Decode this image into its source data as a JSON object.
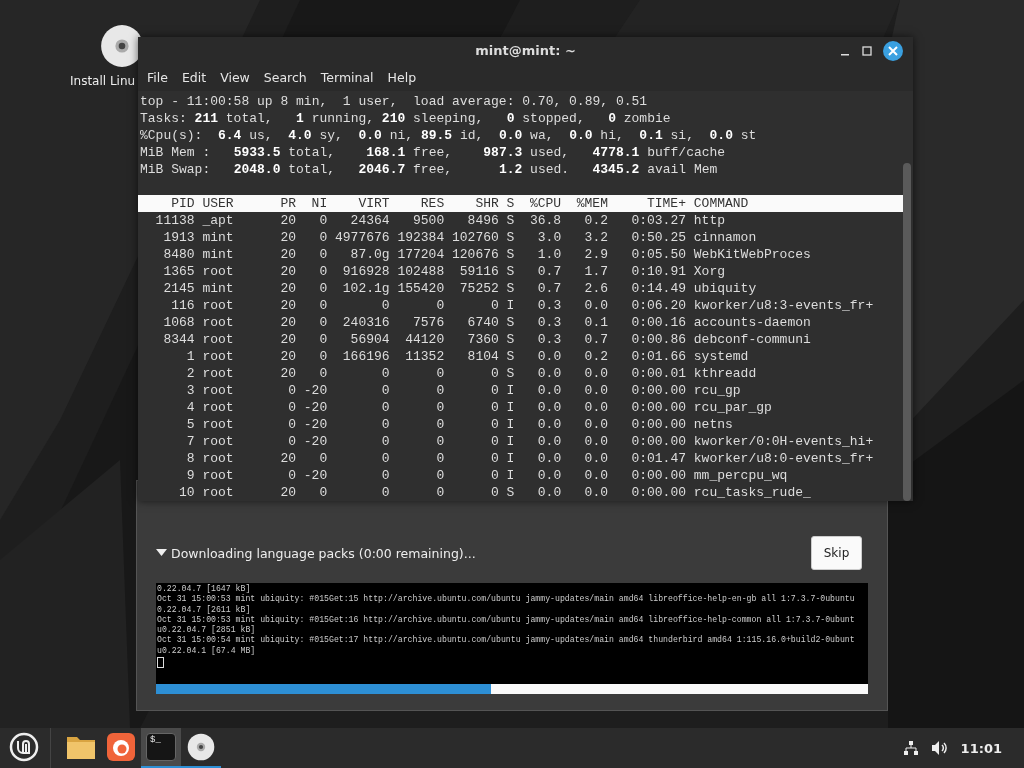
{
  "desktop_icons": [
    {
      "label": "Install Linu"
    }
  ],
  "terminal": {
    "title": "mint@mint: ~",
    "menu": [
      "File",
      "Edit",
      "View",
      "Search",
      "Terminal",
      "Help"
    ],
    "summary": [
      "top - 11:00:58 up 8 min,  1 user,  load average: 0.70, 0.89, 0.51",
      "Tasks: **211** total,   **1** running, **210** sleeping,   **0** stopped,   **0** zombie",
      "%Cpu(s):  **6.4** us,  **4.0** sy,  **0.0** ni, **89.5** id,  **0.0** wa,  **0.0** hi,  **0.1** si,  **0.0** st",
      "MiB Mem :   **5933.5** total,    **168.1** free,    **987.3** used,   **4778.1** buff/cache",
      "MiB Swap:   **2048.0** total,   **2046.7** free,      **1.2** used.   **4345.2** avail Mem"
    ],
    "columns": [
      "PID",
      "USER",
      "PR",
      "NI",
      "VIRT",
      "RES",
      "SHR",
      "S",
      "%CPU",
      "%MEM",
      "TIME+",
      "COMMAND"
    ],
    "rows": [
      [
        "11138",
        "_apt",
        "20",
        "0",
        "24364",
        "9500",
        "8496",
        "S",
        "36.8",
        "0.2",
        "0:03.27",
        "http"
      ],
      [
        "1913",
        "mint",
        "20",
        "0",
        "4977676",
        "192384",
        "102760",
        "S",
        "3.0",
        "3.2",
        "0:50.25",
        "cinnamon"
      ],
      [
        "8480",
        "mint",
        "20",
        "0",
        "87.0g",
        "177204",
        "120676",
        "S",
        "1.0",
        "2.9",
        "0:05.50",
        "WebKitWebProces"
      ],
      [
        "1365",
        "root",
        "20",
        "0",
        "916928",
        "102488",
        "59116",
        "S",
        "0.7",
        "1.7",
        "0:10.91",
        "Xorg"
      ],
      [
        "2145",
        "mint",
        "20",
        "0",
        "102.1g",
        "155420",
        "75252",
        "S",
        "0.7",
        "2.6",
        "0:14.49",
        "ubiquity"
      ],
      [
        "116",
        "root",
        "20",
        "0",
        "0",
        "0",
        "0",
        "I",
        "0.3",
        "0.0",
        "0:06.20",
        "kworker/u8:3-events_fr+"
      ],
      [
        "1068",
        "root",
        "20",
        "0",
        "240316",
        "7576",
        "6740",
        "S",
        "0.3",
        "0.1",
        "0:00.16",
        "accounts-daemon"
      ],
      [
        "8344",
        "root",
        "20",
        "0",
        "56904",
        "44120",
        "7360",
        "S",
        "0.3",
        "0.7",
        "0:00.86",
        "debconf-communi"
      ],
      [
        "1",
        "root",
        "20",
        "0",
        "166196",
        "11352",
        "8104",
        "S",
        "0.0",
        "0.2",
        "0:01.66",
        "systemd"
      ],
      [
        "2",
        "root",
        "20",
        "0",
        "0",
        "0",
        "0",
        "S",
        "0.0",
        "0.0",
        "0:00.01",
        "kthreadd"
      ],
      [
        "3",
        "root",
        "0",
        "-20",
        "0",
        "0",
        "0",
        "I",
        "0.0",
        "0.0",
        "0:00.00",
        "rcu_gp"
      ],
      [
        "4",
        "root",
        "0",
        "-20",
        "0",
        "0",
        "0",
        "I",
        "0.0",
        "0.0",
        "0:00.00",
        "rcu_par_gp"
      ],
      [
        "5",
        "root",
        "0",
        "-20",
        "0",
        "0",
        "0",
        "I",
        "0.0",
        "0.0",
        "0:00.00",
        "netns"
      ],
      [
        "7",
        "root",
        "0",
        "-20",
        "0",
        "0",
        "0",
        "I",
        "0.0",
        "0.0",
        "0:00.00",
        "kworker/0:0H-events_hi+"
      ],
      [
        "8",
        "root",
        "20",
        "0",
        "0",
        "0",
        "0",
        "I",
        "0.0",
        "0.0",
        "0:01.47",
        "kworker/u8:0-events_fr+"
      ],
      [
        "9",
        "root",
        "0",
        "-20",
        "0",
        "0",
        "0",
        "I",
        "0.0",
        "0.0",
        "0:00.00",
        "mm_percpu_wq"
      ],
      [
        "10",
        "root",
        "20",
        "0",
        "0",
        "0",
        "0",
        "S",
        "0.0",
        "0.0",
        "0:00.00",
        "rcu_tasks_rude_"
      ]
    ]
  },
  "installer": {
    "status": "Downloading language packs (0:00 remaining)...",
    "expanded": true,
    "skip": "Skip",
    "log": [
      "0.22.04.7 [1647 kB]",
      "Oct 31 15:00:53 mint ubiquity: #015Get:15 http://archive.ubuntu.com/ubuntu jammy-updates/main amd64 libreoffice-help-en-gb all 1:7.3.7-0ubuntu",
      "0.22.04.7 [2611 kB]",
      "Oct 31 15:00:53 mint ubiquity: #015Get:16 http://archive.ubuntu.com/ubuntu jammy-updates/main amd64 libreoffice-help-common all 1:7.3.7-0ubunt",
      "u0.22.04.7 [2851 kB]",
      "Oct 31 15:00:54 mint ubiquity: #015Get:17 http://archive.ubuntu.com/ubuntu jammy-updates/main amd64 thunderbird amd64 1:115.16.0+build2-0ubunt",
      "u0.22.04.1 [67.4 MB]"
    ],
    "progress": {
      "level": 0.471
    }
  },
  "taskbar": {
    "items": [
      {
        "kind": "menu",
        "selected": false,
        "running": false
      },
      {
        "kind": "folder",
        "selected": false,
        "running": false
      },
      {
        "kind": "browser",
        "selected": false,
        "running": false
      },
      {
        "kind": "terminal",
        "glyph": "$_",
        "selected": true,
        "running": true
      },
      {
        "kind": "disc",
        "selected": false,
        "running": true
      }
    ],
    "clock": "11:01"
  }
}
